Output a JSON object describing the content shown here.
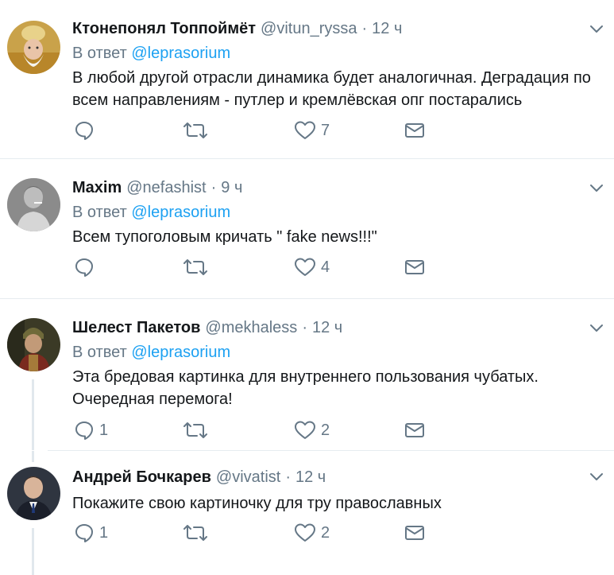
{
  "reply_prefix": "В ответ",
  "tweets": [
    {
      "name": "Ктонепонял Топпоймёт",
      "handle": "@vitun_ryssa",
      "time": "12 ч",
      "reply_to": "@leprasorium",
      "text": "В любой другой отрасли динамика будет аналогичная. Деградация по всем направлениям - путлер и кремлёвская опг постарались",
      "replies": "",
      "retweets": "",
      "likes": "7"
    },
    {
      "name": "Maxim",
      "handle": "@nefashist",
      "time": "9 ч",
      "reply_to": "@leprasorium",
      "text": "Всем тупоголовым кричать \" fake news!!!\"",
      "replies": "",
      "retweets": "",
      "likes": "4"
    },
    {
      "name": "Шелест Пакетов",
      "handle": "@mekhaless",
      "time": "12 ч",
      "reply_to": "@leprasorium",
      "text": "Эта бредовая картинка для внутреннего пользования чубатых. Очередная перемога!",
      "replies": "1",
      "retweets": "",
      "likes": "2"
    },
    {
      "name": "Андрей Бочкарев",
      "handle": "@vivatist",
      "time": "12 ч",
      "reply_to": "",
      "text": "Покажите свою картиночку для тру православных",
      "replies": "1",
      "retweets": "",
      "likes": "2"
    }
  ],
  "colors": {
    "text": "#14171a",
    "secondary": "#657786",
    "link": "#1da1f2",
    "divider": "#e6ecf0"
  }
}
